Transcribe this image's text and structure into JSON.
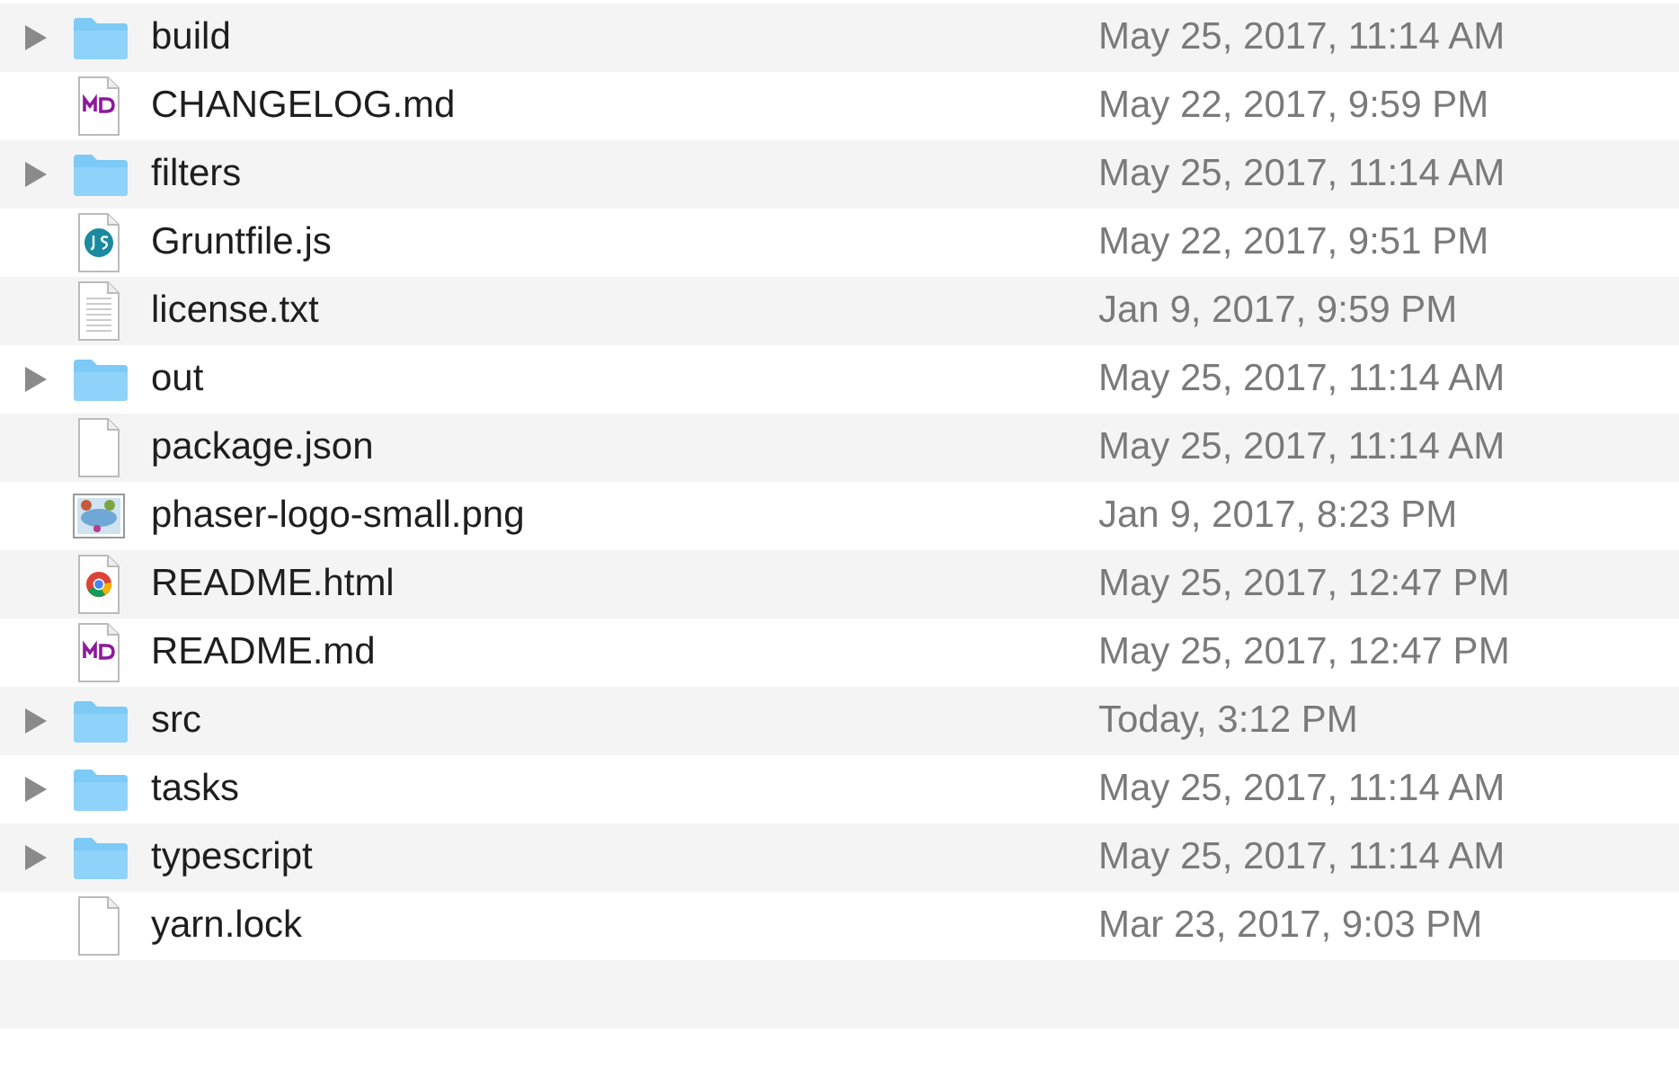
{
  "files": [
    {
      "name": "build",
      "kind": "folder",
      "expanded": false,
      "date": "May 25, 2017, 11:14 AM"
    },
    {
      "name": "CHANGELOG.md",
      "kind": "markdown",
      "date": "May 22, 2017, 9:59 PM"
    },
    {
      "name": "filters",
      "kind": "folder",
      "expanded": false,
      "date": "May 25, 2017, 11:14 AM"
    },
    {
      "name": "Gruntfile.js",
      "kind": "javascript",
      "date": "May 22, 2017, 9:51 PM"
    },
    {
      "name": "license.txt",
      "kind": "text",
      "date": "Jan 9, 2017, 9:59 PM"
    },
    {
      "name": "out",
      "kind": "folder",
      "expanded": false,
      "date": "May 25, 2017, 11:14 AM"
    },
    {
      "name": "package.json",
      "kind": "blank",
      "date": "May 25, 2017, 11:14 AM"
    },
    {
      "name": "phaser-logo-small.png",
      "kind": "image",
      "date": "Jan 9, 2017, 8:23 PM"
    },
    {
      "name": "README.html",
      "kind": "html",
      "date": "May 25, 2017, 12:47 PM"
    },
    {
      "name": "README.md",
      "kind": "markdown",
      "date": "May 25, 2017, 12:47 PM"
    },
    {
      "name": "src",
      "kind": "folder",
      "expanded": false,
      "date": "Today, 3:12 PM"
    },
    {
      "name": "tasks",
      "kind": "folder",
      "expanded": false,
      "date": "May 25, 2017, 11:14 AM"
    },
    {
      "name": "typescript",
      "kind": "folder",
      "expanded": false,
      "date": "May 25, 2017, 11:14 AM"
    },
    {
      "name": "yarn.lock",
      "kind": "blank",
      "date": "Mar 23, 2017, 9:03 PM"
    }
  ]
}
